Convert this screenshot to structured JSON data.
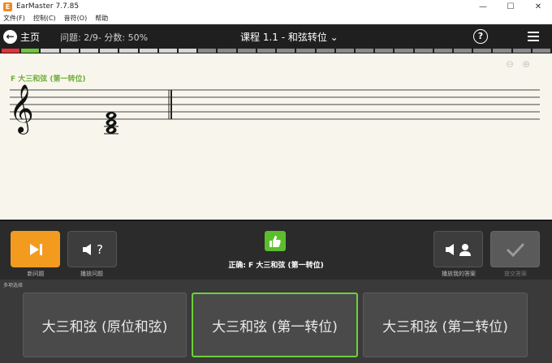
{
  "window": {
    "title": "EarMaster 7.7.85",
    "controls": {
      "minimize": "—",
      "maximize": "☐",
      "close": "✕"
    }
  },
  "menu": [
    "文件(F)",
    "控制(C)",
    "音符(O)",
    "帮助"
  ],
  "header": {
    "home_label": "主页",
    "progress_text": "问题: 2/9- 分数: 50%",
    "lesson_title": "课程 1.1 - 和弦转位 ⌄",
    "help": "?"
  },
  "progress_segments": [
    "red",
    "green",
    "done",
    "done",
    "done",
    "done",
    "done",
    "done",
    "done",
    "done",
    "pending",
    "pending",
    "pending",
    "pending",
    "pending",
    "pending",
    "pending",
    "pending",
    "pending",
    "pending",
    "pending",
    "pending",
    "pending",
    "pending",
    "pending",
    "pending",
    "pending",
    "pending"
  ],
  "colors": {
    "accent": "#f29b1f",
    "correct": "#5bbf2d",
    "title_green": "#6fae3a",
    "seg_red": "#e3323a",
    "seg_green": "#6fc63e",
    "seg_done": "#d6d6d6",
    "seg_pending": "#8a8a8a"
  },
  "staff": {
    "chord_title": "F 大三和弦 (第一转位)",
    "zoom_out": "⊖",
    "zoom_in": "⊕"
  },
  "controls": {
    "new_question": {
      "icon": "skip-next-icon",
      "label": "新问题"
    },
    "play_question": {
      "icon": "speaker-question-icon",
      "label": "播放问题",
      "glyph": "?"
    },
    "answer_text": "正确: F 大三和弦 (第一转位)",
    "play_my_answer": {
      "icon": "speaker-user-icon",
      "label": "播放我的答案"
    },
    "submit": {
      "icon": "checkmark-icon",
      "label": "提交答案"
    }
  },
  "answers": {
    "label": "多项选择",
    "options": [
      "大三和弦 (原位和弦)",
      "大三和弦 (第一转位)",
      "大三和弦 (第二转位)"
    ],
    "selected_index": 1
  }
}
